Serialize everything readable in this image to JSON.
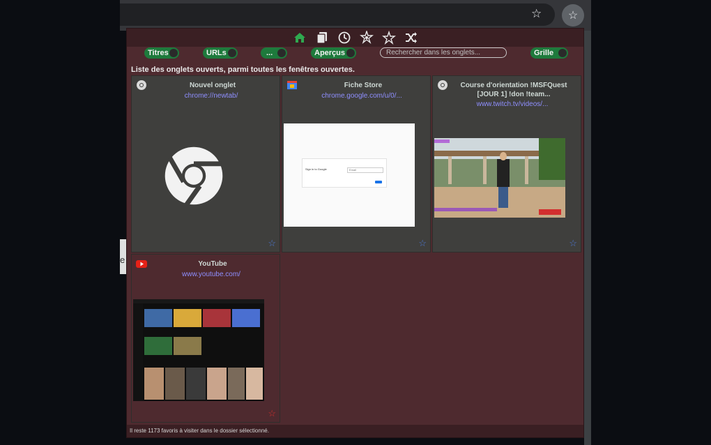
{
  "browser": {
    "star_icon": "star-outline-icon",
    "extension_icon": "star-outline-icon",
    "left_page_letter": "e"
  },
  "toolbar": {
    "icons": [
      "home-icon",
      "copy-icon",
      "history-icon",
      "bookmarks-tree-icon",
      "star-cycle-icon",
      "shuffle-icon"
    ]
  },
  "toggles": {
    "titles": "Titres",
    "urls": "URLs",
    "more": "...",
    "previews": "Aperçus",
    "grid": "Grille"
  },
  "search": {
    "placeholder": "Rechercher dans les onglets..."
  },
  "description": "Liste des onglets ouverts, parmi toutes les fenêtres ouvertes.",
  "tabs": [
    {
      "title": "Nouvel onglet",
      "url": "chrome://newtab/",
      "favicon": "chrome-icon",
      "preview": "chrome-logo"
    },
    {
      "title": "Fiche Store",
      "url": "chrome.google.com/u/0/...",
      "favicon": "store-icon",
      "preview": "sign-in-page"
    },
    {
      "title": "Course d'orientation !MSFQuest [JOUR 1] !don !team...",
      "url": "www.twitch.tv/videos/...",
      "favicon": "chrome-icon",
      "preview": "stream-screenshot"
    },
    {
      "title": "YouTube",
      "url": "www.youtube.com/",
      "favicon": "youtube-icon",
      "preview": "youtube-screenshot"
    }
  ],
  "preview_text": {
    "signin_heading": "Sign in to Google",
    "signin_field": "Email"
  },
  "footer": "Il reste 1173 favoris à visiter dans le dossier sélectionné.",
  "colors": {
    "popup_bg": "#4e2a2f",
    "toggle_green": "#1e7a3c",
    "url_color": "#8f8fff",
    "star_blue": "#4d78d6"
  }
}
